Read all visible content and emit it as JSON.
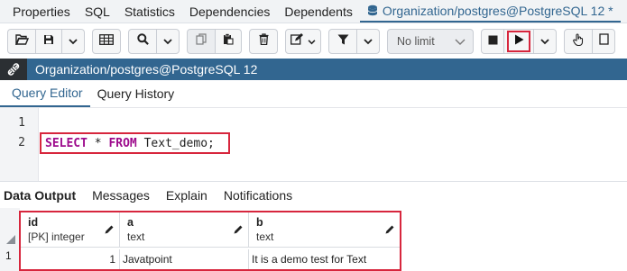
{
  "top_tabs": [
    {
      "label": "Properties"
    },
    {
      "label": "SQL"
    },
    {
      "label": "Statistics"
    },
    {
      "label": "Dependencies"
    },
    {
      "label": "Dependents"
    },
    {
      "label": "Organization/postgres@PostgreSQL 12 *",
      "active": true
    }
  ],
  "toolbar": {
    "limit_value": "No limit"
  },
  "panel": {
    "title": "Organization/postgres@PostgreSQL 12"
  },
  "editor_tabs": [
    {
      "label": "Query Editor",
      "active": true
    },
    {
      "label": "Query History"
    }
  ],
  "editor": {
    "line_numbers": [
      "1",
      "2"
    ],
    "keyword_select": "SELECT",
    "keyword_from": "FROM",
    "code_mid": " * ",
    "code_end": " Text_demo;"
  },
  "result_tabs": [
    {
      "label": "Data Output",
      "active": true
    },
    {
      "label": "Messages"
    },
    {
      "label": "Explain"
    },
    {
      "label": "Notifications"
    }
  ],
  "grid": {
    "columns": [
      {
        "name": "id",
        "type": "[PK] integer"
      },
      {
        "name": "a",
        "type": "text"
      },
      {
        "name": "b",
        "type": "text"
      }
    ],
    "rows": [
      {
        "row_number": "1",
        "cells": [
          "1",
          "Javatpoint",
          "It is a demo test for Text"
        ]
      }
    ]
  },
  "colors": {
    "accent": "#326690",
    "highlight_box": "#d7263d",
    "keyword": "#9d0a8c"
  }
}
